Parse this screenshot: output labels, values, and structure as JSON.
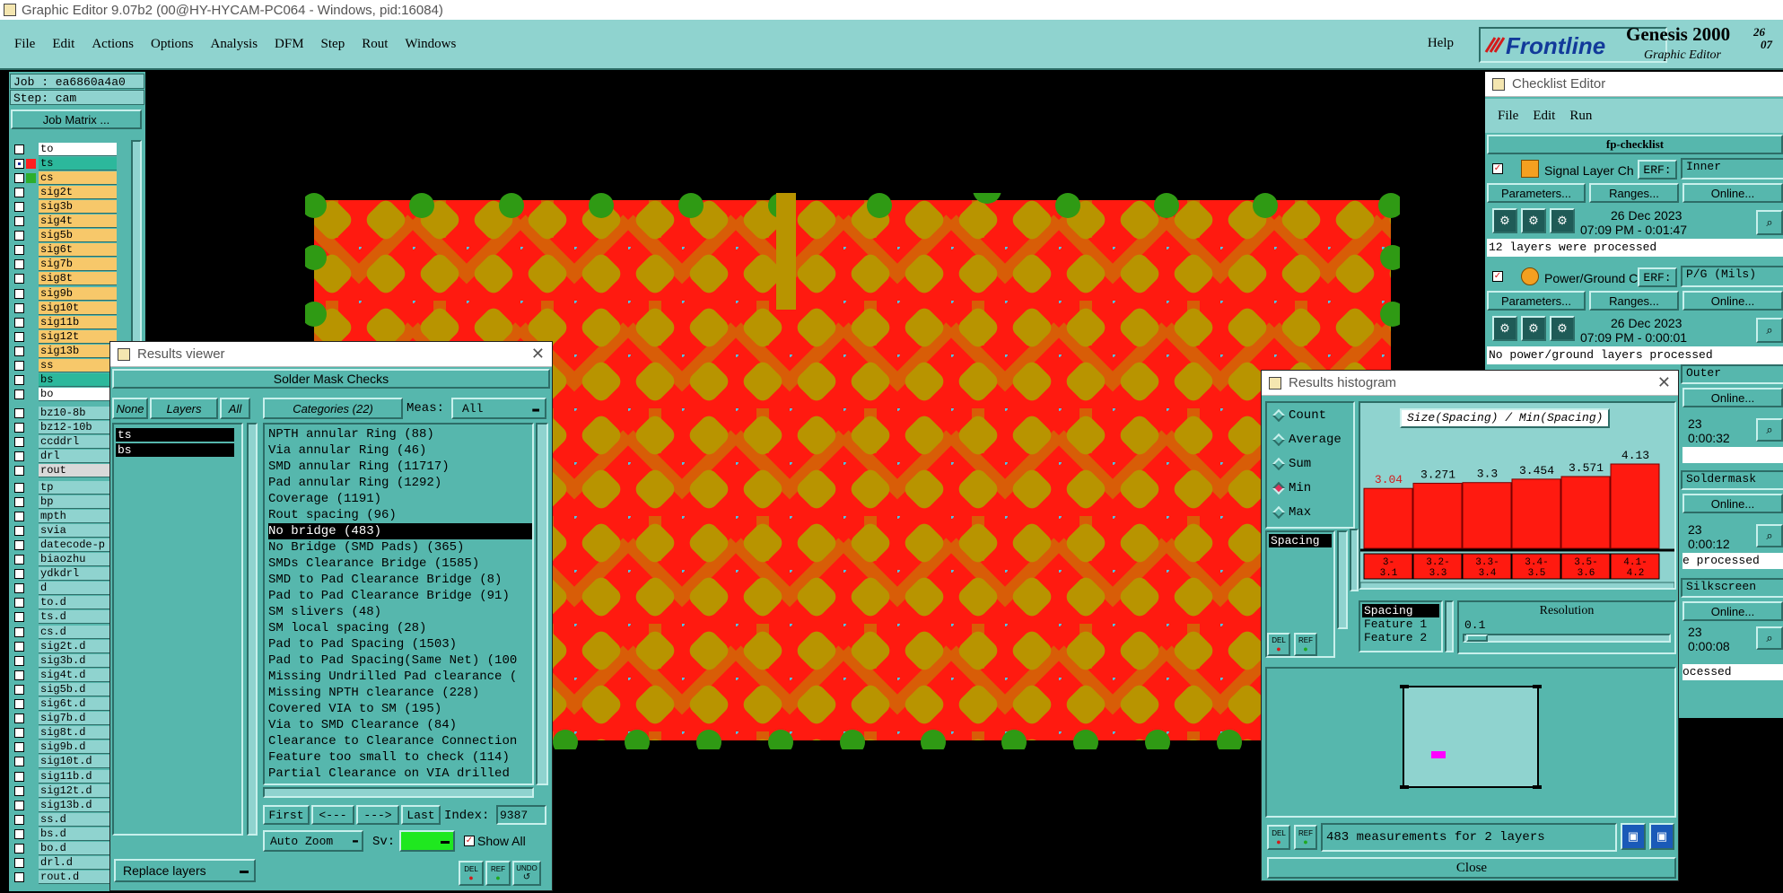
{
  "window_title": "Graphic Editor 9.07b2 (00@HY-HYCAM-PC064 - Windows, pid:16084)",
  "menu": [
    "File",
    "Edit",
    "Actions",
    "Options",
    "Analysis",
    "DFM",
    "Step",
    "Rout",
    "Windows"
  ],
  "help": "Help",
  "brand": {
    "logo": "Frontline",
    "product": "Genesis 2000",
    "subtitle": "Graphic Editor",
    "clock_a": "26",
    "clock_b": "07"
  },
  "job": {
    "job_label": "Job : ea6860a4a0",
    "step_label": "Step: cam",
    "matrix_button": "Job Matrix ..."
  },
  "layers": [
    {
      "name": "to",
      "color": "#ffffff",
      "sel": false
    },
    {
      "name": "ts",
      "color": "#2cb89c",
      "sel": true,
      "swatch": "#ff1e1e",
      "mark": "▪"
    },
    {
      "name": "cs",
      "color": "#f7c86a",
      "sel": false,
      "swatch": "#2cae2c"
    },
    {
      "name": "sig2t",
      "color": "#f7c86a",
      "sel": false
    },
    {
      "name": "sig3b",
      "color": "#f7c86a",
      "sel": false
    },
    {
      "name": "sig4t",
      "color": "#f7c86a",
      "sel": false
    },
    {
      "name": "sig5b",
      "color": "#f7c86a",
      "sel": false
    },
    {
      "name": "sig6t",
      "color": "#f7c86a",
      "sel": false
    },
    {
      "name": "sig7b",
      "color": "#f7c86a",
      "sel": false
    },
    {
      "name": "sig8t",
      "color": "#f7c86a",
      "sel": false
    },
    {
      "name": "sig9b",
      "color": "#f7c86a",
      "sel": false
    },
    {
      "name": "sig10t",
      "color": "#f7c86a",
      "sel": false
    },
    {
      "name": "sig11b",
      "color": "#f7c86a",
      "sel": false
    },
    {
      "name": "sig12t",
      "color": "#f7c86a",
      "sel": false
    },
    {
      "name": "sig13b",
      "color": "#f7c86a",
      "sel": false
    },
    {
      "name": "ss",
      "color": "#f7c86a",
      "sel": false
    },
    {
      "name": "bs",
      "color": "#2cb89c",
      "sel": false
    },
    {
      "name": "bo",
      "color": "#ffffff",
      "sel": false
    }
  ],
  "layers2": [
    "bz10-8b",
    "bz12-10b",
    "ccddrl",
    "drl",
    "rout"
  ],
  "layers3": [
    "tp",
    "bp",
    "mpth",
    "svia",
    "datecode-p",
    "biaozhu",
    "ydkdrl",
    "d",
    "to.d",
    "ts.d",
    "cs.d",
    "sig2t.d",
    "sig3b.d",
    "sig4t.d",
    "sig5b.d",
    "sig6t.d",
    "sig7b.d",
    "sig8t.d",
    "sig9b.d",
    "sig10t.d",
    "sig11b.d",
    "sig12t.d",
    "sig13b.d",
    "ss.d",
    "bs.d",
    "bo.d",
    "drl.d",
    "rout.d"
  ],
  "results_viewer": {
    "title": "Results viewer",
    "header": "Solder Mask Checks",
    "none_btn": "None",
    "layers_btn": "Layers",
    "all_btn": "All",
    "categories_btn": "Categories (22)",
    "meas_label": "Meas:",
    "meas_value": "All",
    "layer_items": [
      "ts",
      "bs"
    ],
    "categories": [
      "NPTH annular Ring (88)",
      "Via annular Ring (46)",
      "SMD annular Ring (11717)",
      "Pad annular Ring (1292)",
      "Coverage (1191)",
      "Rout spacing (96)",
      "No bridge (483)",
      "No Bridge (SMD Pads) (365)",
      "SMDs Clearance Bridge (1585)",
      "SMD to Pad Clearance Bridge (8)",
      "Pad to Pad Clearance Bridge (91)",
      "SM slivers (48)",
      "SM local spacing (28)",
      "Pad to Pad Spacing (1503)",
      "Pad to Pad Spacing(Same Net) (100",
      "Missing Undrilled Pad clearance (",
      "Missing NPTH clearance (228)",
      "Covered VIA to SM (195)",
      "Via to SMD Clearance (84)",
      "Clearance to Clearance Connection",
      "Feature too small to check (114)",
      "Partial Clearance on VIA drilled"
    ],
    "selected_category": "No bridge (483)",
    "first": "First",
    "prev": "<---",
    "next": "--->",
    "last": "Last",
    "index_label": "Index:",
    "index_value": "9387",
    "auto_zoom": "Auto Zoom",
    "sv_label": "Sv:",
    "show_all": "Show All",
    "replace_layers": "Replace layers",
    "del": "DEL",
    "ref": "REF",
    "undo": "UNDO"
  },
  "checklist_editor": {
    "title": "Checklist Editor",
    "menu": [
      "File",
      "Edit",
      "Run"
    ],
    "checklist": "fp-checklist",
    "items": [
      {
        "name": "Signal Layer Ch",
        "erf": "ERF:",
        "erf_value": "Inner",
        "date": "26 Dec 2023",
        "time": "07:09 PM - 0:01:47",
        "status": "12 layers were processed"
      },
      {
        "name": "Power/Ground C",
        "erf": "ERF:",
        "erf_value": "P/G (Mils)",
        "date": "26 Dec 2023",
        "time": "07:09 PM - 0:00:01",
        "status": "No power/ground layers processed"
      }
    ],
    "params": "Parameters...",
    "ranges": "Ranges...",
    "online": "Online...",
    "partial": [
      {
        "erf_value": "Outer",
        "date": "23",
        "time": "0:00:32"
      },
      {
        "erf_value": "Soldermask",
        "date": "23",
        "time": "0:00:12",
        "status": "e processed"
      },
      {
        "erf_value": "Silkscreen",
        "date": "23",
        "time": "0:00:08",
        "status": "ocessed"
      }
    ]
  },
  "histogram": {
    "title": "Results histogram",
    "modes": [
      "Count",
      "Average",
      "Sum",
      "Min",
      "Max"
    ],
    "selected_mode": "Min",
    "list_item": "Spacing",
    "chart_title": "Size(Spacing) / Min(Spacing)",
    "bars": [
      {
        "value": "3.04",
        "v": 3.04,
        "label": "3-3.1",
        "highlight": true
      },
      {
        "value": "3.271",
        "v": 3.271,
        "label": "3.2-3.3"
      },
      {
        "value": "3.3",
        "v": 3.3,
        "label": "3.3-3.4"
      },
      {
        "value": "3.454",
        "v": 3.454,
        "label": "3.4-3.5"
      },
      {
        "value": "3.571",
        "v": 3.571,
        "label": "3.5-3.6"
      },
      {
        "value": "4.13",
        "v": 4.13,
        "label": "4.1-4.2"
      }
    ],
    "fields": [
      "Spacing",
      "Feature 1",
      "Feature 2"
    ],
    "resolution_label": "Resolution",
    "resolution_value": "0.1",
    "status": "483 measurements for 2 layers",
    "close": "Close",
    "del": "DEL",
    "ref": "REF"
  }
}
